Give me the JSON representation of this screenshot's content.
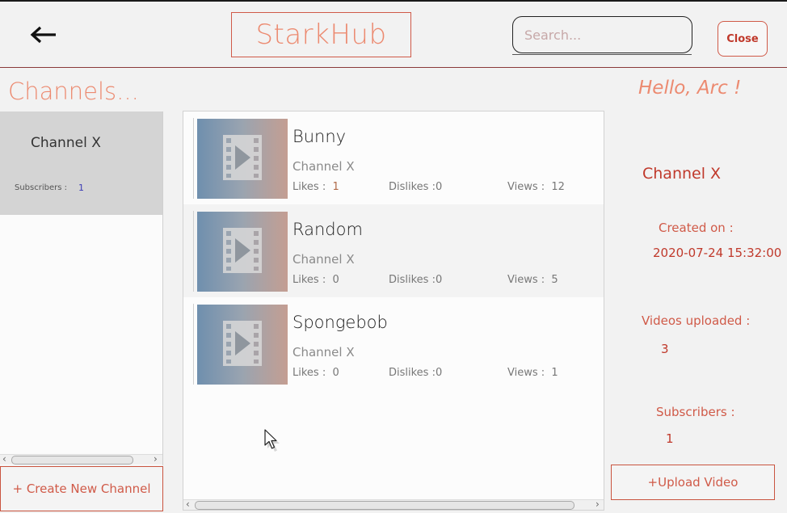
{
  "header": {
    "brand": "StarkHub",
    "search_placeholder": "Search...",
    "close_label": "Close"
  },
  "sidebar": {
    "title": "Channels...",
    "channels": [
      {
        "name": "Channel X",
        "subscribers_label": "Subscribers :",
        "subscribers": "1"
      }
    ],
    "create_label": "+ Create New Channel"
  },
  "videos": [
    {
      "title": "Bunny",
      "channel": "Channel X",
      "likes_label": "Likes :",
      "likes": "1",
      "dislikes_label": "Dislikes :",
      "dislikes": "0",
      "views_label": "Views :",
      "views": "12"
    },
    {
      "title": "Random",
      "channel": "Channel X",
      "likes_label": "Likes :",
      "likes": "0",
      "dislikes_label": "Dislikes :",
      "dislikes": "0",
      "views_label": "Views :",
      "views": "5"
    },
    {
      "title": "Spongebob",
      "channel": "Channel X",
      "likes_label": "Likes :",
      "likes": "0",
      "dislikes_label": "Dislikes :",
      "dislikes": "0",
      "views_label": "Views :",
      "views": "1"
    }
  ],
  "info": {
    "greeting": "Hello, Arc !",
    "channel_name": "Channel X",
    "created_label": "Created on :",
    "created_value": "2020-07-24 15:32:00",
    "videos_label": "Videos uploaded :",
    "videos_value": "3",
    "subscribers_label": "Subscribers :",
    "subscribers_value": "1",
    "upload_label": "+Upload Video"
  },
  "icons": {
    "back": "arrow-left-icon",
    "thumbnail": "video-placeholder-icon",
    "cursor": "mouse-pointer-icon"
  },
  "colors": {
    "accent": "#ec8a70",
    "accent_dark": "#c0392b",
    "selected_channel_bg": "#d4d4d4"
  }
}
